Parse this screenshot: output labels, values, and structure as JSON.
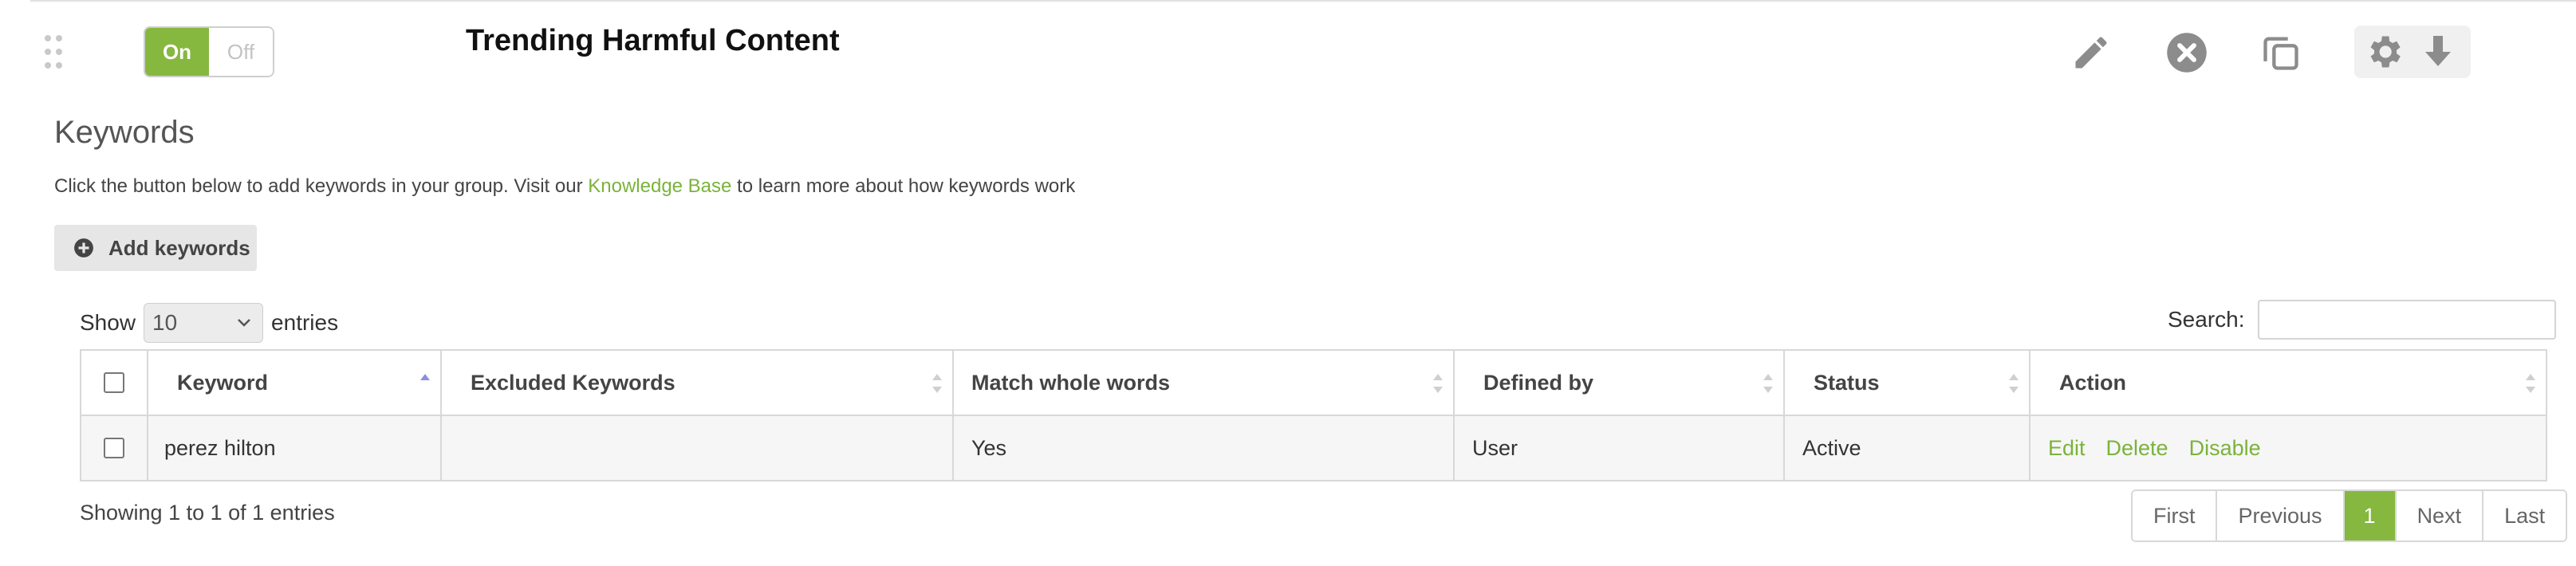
{
  "group": {
    "title": "Trending Harmful Content",
    "toggle": {
      "on_label": "On",
      "off_label": "Off",
      "state": "on"
    }
  },
  "header_icons": [
    "pencil-icon",
    "close-circle-icon",
    "copy-icon",
    "gear-icon",
    "download-arrow-icon"
  ],
  "section": {
    "title": "Keywords",
    "desc_before": "Click the button below to add keywords in your group. Visit our ",
    "desc_link": "Knowledge Base",
    "desc_after": " to learn more about how keywords work",
    "add_button": "Add keywords"
  },
  "controls": {
    "show_label": "Show",
    "entries_value": "10",
    "entries_label": "entries",
    "search_label": "Search:",
    "search_value": ""
  },
  "table": {
    "columns": [
      "Keyword",
      "Excluded Keywords",
      "Match whole words",
      "Defined by",
      "Status",
      "Action"
    ],
    "rows": [
      {
        "keyword": "perez hilton",
        "excluded": "",
        "match_whole": "Yes",
        "defined_by": "User",
        "status": "Active",
        "actions": [
          "Edit",
          "Delete",
          "Disable"
        ]
      }
    ]
  },
  "footer": {
    "info": "Showing 1 to 1 of 1 entries",
    "pagination": [
      "First",
      "Previous",
      "1",
      "Next",
      "Last"
    ],
    "current_page": "1"
  },
  "colors": {
    "accent": "#86b83f",
    "link": "#7ab33b",
    "border": "#d8d8d8"
  }
}
